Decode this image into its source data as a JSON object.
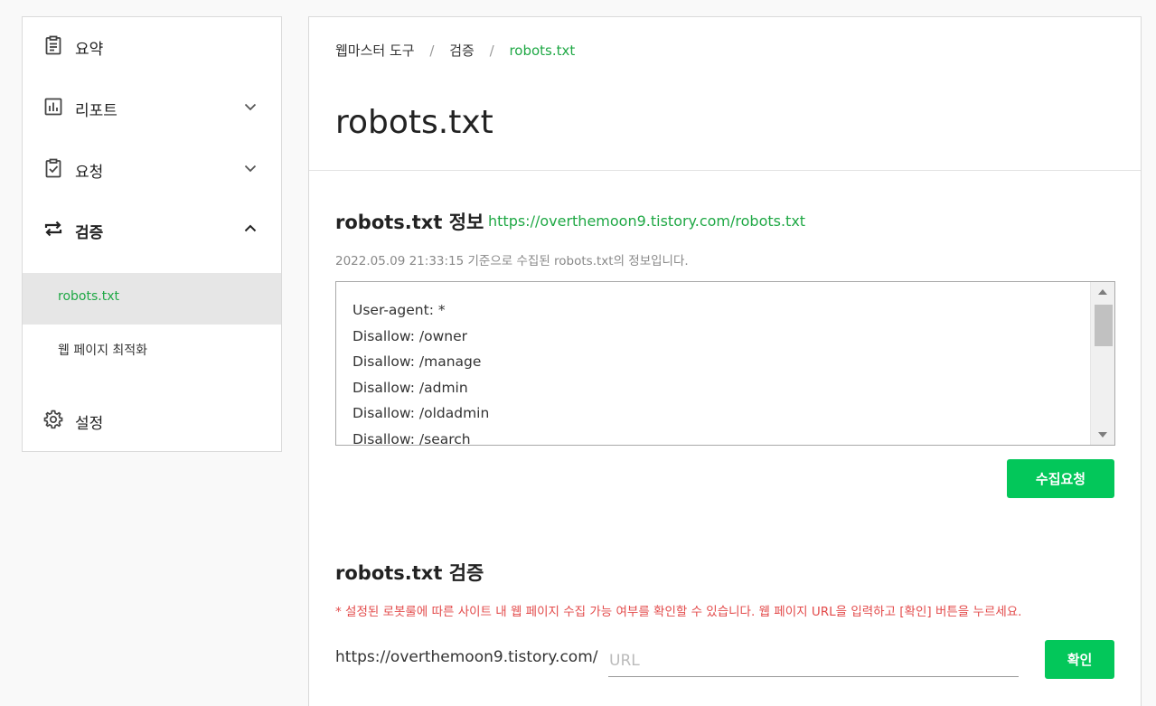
{
  "sidebar": {
    "items": [
      {
        "label": "요약",
        "icon": "clipboard-icon"
      },
      {
        "label": "리포트",
        "icon": "bar-chart-icon"
      },
      {
        "label": "요청",
        "icon": "clipboard-check-icon"
      },
      {
        "label": "검증",
        "icon": "repeat-arrows-icon"
      },
      {
        "label": "설정",
        "icon": "gear-icon"
      }
    ],
    "sub_items": [
      {
        "label": "robots.txt"
      },
      {
        "label": "웹 페이지 최적화"
      }
    ]
  },
  "breadcrumb": {
    "items": [
      "웹마스터 도구",
      "검증",
      "robots.txt"
    ],
    "separator": "/"
  },
  "page": {
    "title": "robots.txt"
  },
  "info_section": {
    "title": "robots.txt 정보",
    "link": "https://overthemoon9.tistory.com/robots.txt",
    "description": "2022.05.09 21:33:15 기준으로 수집된 robots.txt의 정보입니다.",
    "lines": [
      "User-agent: *",
      "Disallow: /owner",
      "Disallow: /manage",
      "Disallow: /admin",
      "Disallow: /oldadmin",
      "Disallow: /search"
    ],
    "request_button": "수집요청"
  },
  "verify_section": {
    "title": "robots.txt 검증",
    "warning": "* 설정된 로봇룰에 따른 사이트 내 웹 페이지 수집 가능 여부를 확인할 수 있습니다. 웹 페이지 URL을 입력하고 [확인] 버튼을 누르세요.",
    "url_prefix": "https://overthemoon9.tistory.com/",
    "url_placeholder": "URL",
    "url_value": "",
    "confirm_button": "확인"
  },
  "colors": {
    "accent": "#03c75a",
    "link_green": "#1fa845",
    "warning_red": "#e34b4b"
  }
}
